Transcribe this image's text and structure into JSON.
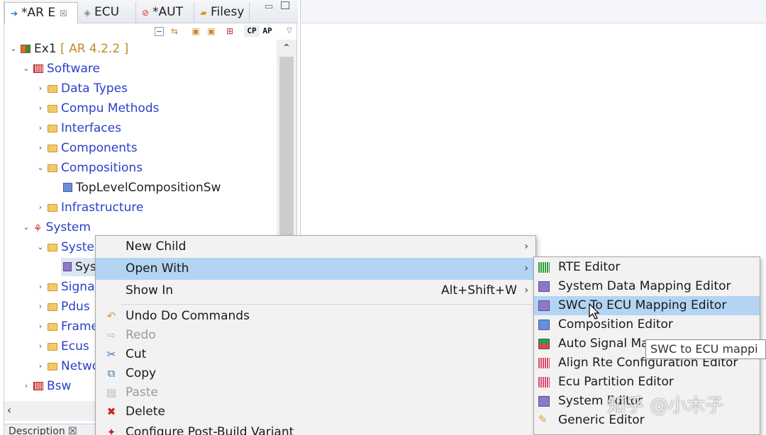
{
  "tabs": [
    {
      "label": "*AR E",
      "icon": "arrow-icon",
      "closable": true
    },
    {
      "label": "ECU",
      "icon": "ecu-icon"
    },
    {
      "label": "*AUT",
      "icon": "autosar-icon"
    },
    {
      "label": "Filesy",
      "icon": "filesystem-icon"
    }
  ],
  "toolbar": {
    "cp_label": "CP",
    "ap_label": "AP"
  },
  "tree": {
    "root": {
      "label": "Ex1",
      "version": "[ AR 4.2.2 ]"
    },
    "software": "Software",
    "software_children": [
      "Data Types",
      "Compu Methods",
      "Interfaces",
      "Components",
      "Compositions"
    ],
    "composition_child": "TopLevelCompositionSw",
    "infrastructure": "Infrastructure",
    "system": "System",
    "system_children": [
      "Systen",
      "Sys",
      "Signa",
      "Pdus",
      "Frame",
      "Ecus",
      "Netwo"
    ],
    "bsw": "Bsw"
  },
  "bottom_tab": "Description ☒",
  "context_menu": {
    "items": [
      {
        "label": "New Child",
        "shortcut": "",
        "submenu": true,
        "icon": "",
        "disabled": false
      },
      {
        "label": "Open With",
        "shortcut": "",
        "submenu": true,
        "icon": "",
        "disabled": false,
        "highlighted": true
      },
      {
        "label": "Show In",
        "shortcut": "Alt+Shift+W",
        "submenu": true,
        "icon": "",
        "disabled": false
      },
      {
        "label": "Undo Do Commands",
        "shortcut": "",
        "submenu": false,
        "icon": "undo-icon",
        "disabled": false
      },
      {
        "label": "Redo",
        "shortcut": "",
        "submenu": false,
        "icon": "redo-icon",
        "disabled": true
      },
      {
        "label": "Cut",
        "shortcut": "",
        "submenu": false,
        "icon": "cut-icon",
        "disabled": false
      },
      {
        "label": "Copy",
        "shortcut": "",
        "submenu": false,
        "icon": "copy-icon",
        "disabled": false
      },
      {
        "label": "Paste",
        "shortcut": "",
        "submenu": false,
        "icon": "paste-icon",
        "disabled": true
      },
      {
        "label": "Delete",
        "shortcut": "",
        "submenu": false,
        "icon": "delete-icon",
        "disabled": false
      },
      {
        "label": "Configure Post-Build Variant",
        "shortcut": "",
        "submenu": false,
        "icon": "configure-icon",
        "disabled": false
      }
    ]
  },
  "submenu": {
    "items": [
      {
        "label": "RTE Editor",
        "icon": "rte-editor-icon"
      },
      {
        "label": "System Data Mapping Editor",
        "icon": "system-data-mapping-icon"
      },
      {
        "label": "SWC To ECU Mapping Editor",
        "icon": "swc-ecu-mapping-icon",
        "highlighted": true
      },
      {
        "label": "Composition Editor",
        "icon": "composition-editor-icon"
      },
      {
        "label": "Auto Signal Ma",
        "icon": "auto-signal-icon"
      },
      {
        "label": "Align Rte Configuration Editor",
        "icon": "align-rte-icon"
      },
      {
        "label": "Ecu Partition Editor",
        "icon": "ecu-partition-icon"
      },
      {
        "label": "System Editor",
        "icon": "system-editor-icon"
      },
      {
        "label": "Generic Editor",
        "icon": "generic-editor-icon"
      }
    ]
  },
  "tooltip": "SWC to ECU mappi",
  "watermark": "知乎 @小木子",
  "colors": {
    "highlight": "#b3d4f3",
    "tree_label": "#2a3fc8",
    "version": "#c08a2a",
    "menu_bg": "#f2f2f2"
  }
}
